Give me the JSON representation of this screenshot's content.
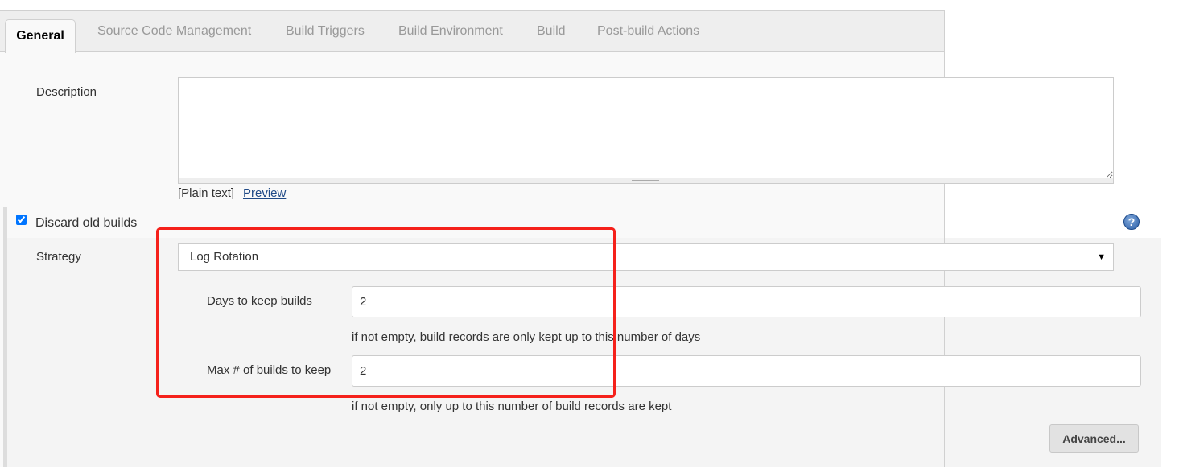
{
  "tabs": [
    {
      "label": "General",
      "active": true
    },
    {
      "label": "Source Code Management"
    },
    {
      "label": "Build Triggers"
    },
    {
      "label": "Build Environment"
    },
    {
      "label": "Build"
    },
    {
      "label": "Post-build Actions"
    }
  ],
  "description": {
    "label": "Description",
    "value": "",
    "format_text": "[Plain text]",
    "preview_link": "Preview"
  },
  "discard": {
    "label": "Discard old builds",
    "checked": true,
    "help_icon": "help-icon"
  },
  "strategy": {
    "label": "Strategy",
    "selected": "Log Rotation"
  },
  "days": {
    "label": "Days to keep builds",
    "value": "2",
    "hint": "if not empty, build records are only kept up to this number of days"
  },
  "max": {
    "label": "Max # of builds to keep",
    "value": "2",
    "hint": "if not empty, only up to this number of build records are kept"
  },
  "advanced_label": "Advanced...",
  "colors": {
    "highlight": "#f5211b",
    "link": "#204a87"
  }
}
